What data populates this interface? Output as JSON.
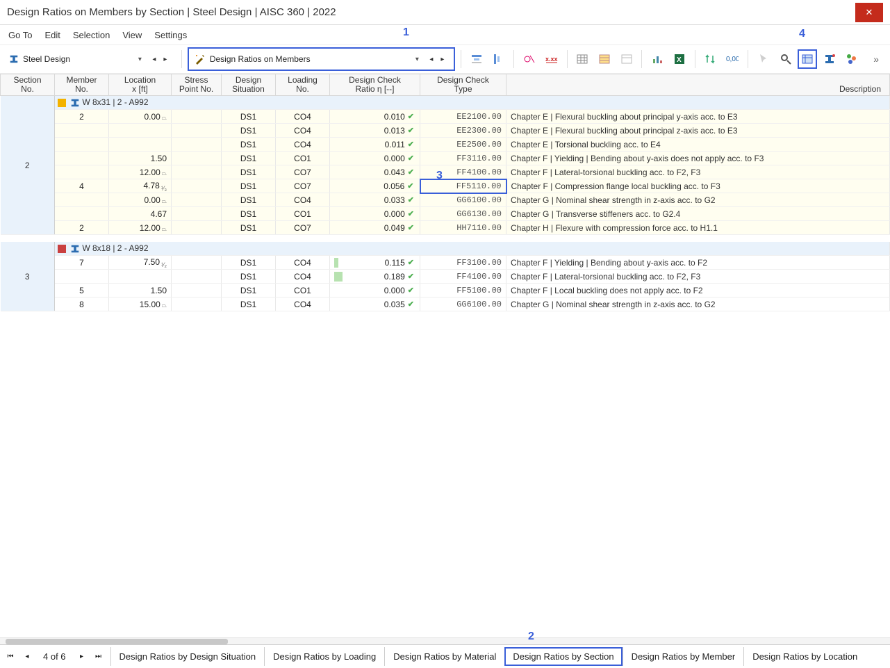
{
  "title": "Design Ratios on Members by Section | Steel Design | AISC 360 | 2022",
  "menu": {
    "goto": "Go To",
    "edit": "Edit",
    "selection": "Selection",
    "view": "View",
    "settings": "Settings"
  },
  "toolbar": {
    "combo1": "Steel Design",
    "combo2": "Design Ratios on Members"
  },
  "callouts": {
    "c1": "1",
    "c2": "2",
    "c3": "3",
    "c4": "4"
  },
  "columns": {
    "section1": "Section",
    "section2": "No.",
    "member1": "Member",
    "member2": "No.",
    "loc1": "Location",
    "loc2": "x [ft]",
    "stress1": "Stress",
    "stress2": "Point No.",
    "situ1": "Design",
    "situ2": "Situation",
    "load1": "Loading",
    "load2": "No.",
    "ratio1": "Design Check",
    "ratio2": "Ratio η [--]",
    "type1": "Design Check",
    "type2": "Type",
    "desc": "Description"
  },
  "groups": [
    {
      "sectionNo": "2",
      "swatch": "#f3b200",
      "label": "W 8x31 | 2 - A992",
      "yellow": true,
      "rows": [
        {
          "member": "2",
          "loc": "0.00",
          "sym": "⏢",
          "ds": "DS1",
          "co": "CO4",
          "ratio": "0.010",
          "code": "EE2100.00",
          "desc": "Chapter E | Flexural buckling about principal y-axis acc. to E3"
        },
        {
          "member": "",
          "loc": "",
          "sym": "",
          "ds": "DS1",
          "co": "CO4",
          "ratio": "0.013",
          "code": "EE2300.00",
          "desc": "Chapter E | Flexural buckling about principal z-axis acc. to E3"
        },
        {
          "member": "",
          "loc": "",
          "sym": "",
          "ds": "DS1",
          "co": "CO4",
          "ratio": "0.011",
          "code": "EE2500.00",
          "desc": "Chapter E | Torsional buckling acc. to E4"
        },
        {
          "member": "",
          "loc": "1.50",
          "sym": "",
          "ds": "DS1",
          "co": "CO1",
          "ratio": "0.000",
          "code": "FF3110.00",
          "desc": "Chapter F | Yielding | Bending about y-axis does not apply acc. to F3"
        },
        {
          "member": "",
          "loc": "12.00",
          "sym": "⏢",
          "ds": "DS1",
          "co": "CO7",
          "ratio": "0.043",
          "code": "FF4100.00",
          "desc": "Chapter F | Lateral-torsional buckling acc. to F2, F3"
        },
        {
          "member": "4",
          "loc": "4.78",
          "frac": "¹⁄₃",
          "sym": "",
          "ds": "DS1",
          "co": "CO7",
          "ratio": "0.056",
          "code": "FF5110.00",
          "hl": true,
          "desc": "Chapter F | Compression flange local buckling acc. to F3"
        },
        {
          "member": "",
          "loc": "0.00",
          "sym": "⏢",
          "ds": "DS1",
          "co": "CO4",
          "ratio": "0.033",
          "code": "GG6100.00",
          "desc": "Chapter G | Nominal shear strength in z-axis acc. to G2"
        },
        {
          "member": "",
          "loc": "4.67",
          "sym": "",
          "ds": "DS1",
          "co": "CO1",
          "ratio": "0.000",
          "code": "GG6130.00",
          "desc": "Chapter G | Transverse stiffeners acc. to G2.4"
        },
        {
          "member": "2",
          "loc": "12.00",
          "sym": "⏢",
          "ds": "DS1",
          "co": "CO7",
          "ratio": "0.049",
          "code": "HH7110.00",
          "desc": "Chapter H | Flexure with compression force acc. to H1.1"
        }
      ]
    },
    {
      "sectionNo": "3",
      "swatch": "#c94040",
      "label": "W 8x18 | 2 - A992",
      "yellow": false,
      "rows": [
        {
          "member": "7",
          "loc": "7.50",
          "frac": "¹⁄₂",
          "sym": "",
          "ds": "DS1",
          "co": "CO4",
          "ratio": "0.115",
          "bar": true,
          "code": "FF3100.00",
          "desc": "Chapter F | Yielding | Bending about y-axis acc. to F2"
        },
        {
          "member": "",
          "loc": "",
          "sym": "",
          "ds": "DS1",
          "co": "CO4",
          "ratio": "0.189",
          "bar": true,
          "barw": 12,
          "code": "FF4100.00",
          "desc": "Chapter F | Lateral-torsional buckling acc. to F2, F3"
        },
        {
          "member": "5",
          "loc": "1.50",
          "sym": "",
          "ds": "DS1",
          "co": "CO1",
          "ratio": "0.000",
          "code": "FF5100.00",
          "desc": "Chapter F | Local buckling does not apply acc. to F2"
        },
        {
          "member": "8",
          "loc": "15.00",
          "sym": "⏢",
          "ds": "DS1",
          "co": "CO4",
          "ratio": "0.035",
          "code": "GG6100.00",
          "desc": "Chapter G | Nominal shear strength in z-axis acc. to G2"
        }
      ]
    }
  ],
  "footer": {
    "page": "4 of 6",
    "tabs": [
      "Design Ratios by Design Situation",
      "Design Ratios by Loading",
      "Design Ratios by Material",
      "Design Ratios by Section",
      "Design Ratios by Member",
      "Design Ratios by Location"
    ],
    "activeTab": 3
  }
}
